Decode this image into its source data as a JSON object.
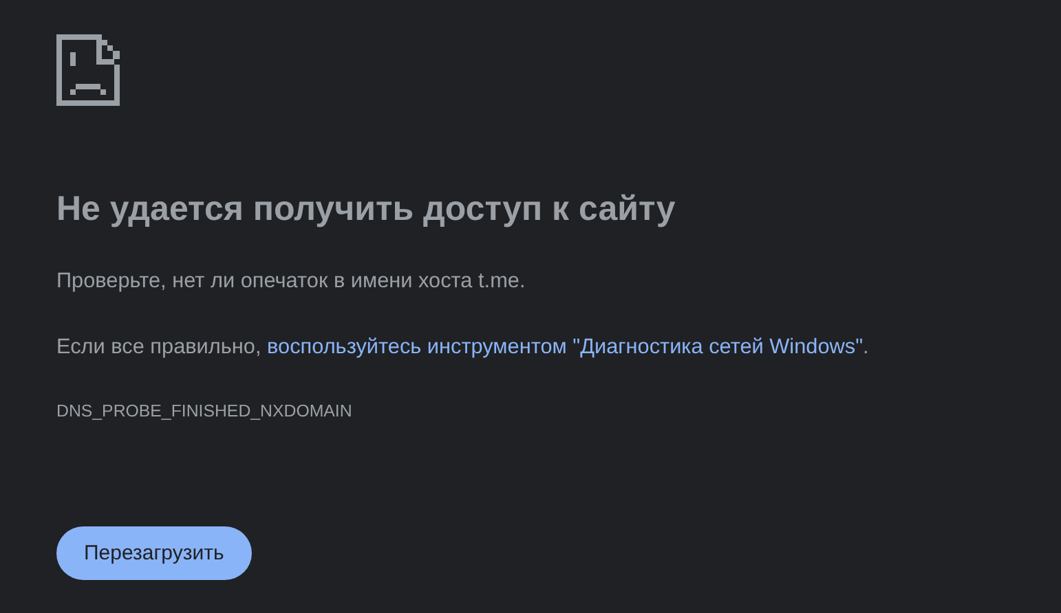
{
  "error_page": {
    "title": "Не удается получить доступ к сайту",
    "hint": "Проверьте, нет ли опечаток в имени хоста t.me.",
    "suggestion": {
      "before": "Если все правильно, ",
      "link": "воспользуйтесь инструментом \"Диагностика сетей Windows\"",
      "after": "."
    },
    "error_code": "DNS_PROBE_FINISHED_NXDOMAIN",
    "reload_button": "Перезагрузить"
  }
}
